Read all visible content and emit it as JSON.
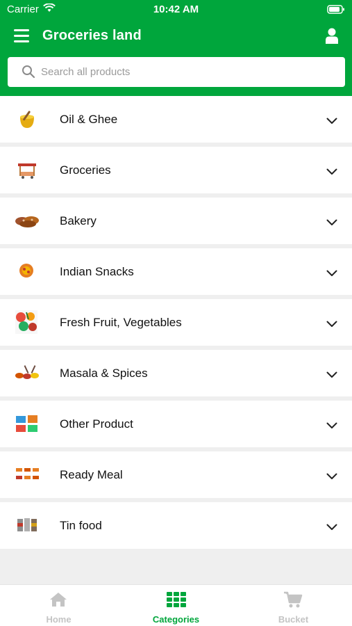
{
  "status_bar": {
    "carrier": "Carrier",
    "time": "10:42 AM"
  },
  "app": {
    "title": "Groceries land"
  },
  "search": {
    "placeholder": "Search all products"
  },
  "categories": [
    {
      "label": "Oil & Ghee",
      "icon": "oil-ghee-icon"
    },
    {
      "label": "Groceries",
      "icon": "groceries-icon"
    },
    {
      "label": "Bakery",
      "icon": "bakery-icon"
    },
    {
      "label": "Indian Snacks",
      "icon": "indian-snacks-icon"
    },
    {
      "label": "Fresh Fruit, Vegetables",
      "icon": "fruit-vegetables-icon"
    },
    {
      "label": "Masala & Spices",
      "icon": "masala-spices-icon"
    },
    {
      "label": "Other Product",
      "icon": "other-product-icon"
    },
    {
      "label": "Ready Meal",
      "icon": "ready-meal-icon"
    },
    {
      "label": "Tin food",
      "icon": "tin-food-icon"
    }
  ],
  "bottom_nav": {
    "home": "Home",
    "categories": "Categories",
    "bucket": "Bucket",
    "active": "Categories"
  },
  "colors": {
    "brand_green": "#00a63c",
    "inactive": "#c4c4c4"
  }
}
